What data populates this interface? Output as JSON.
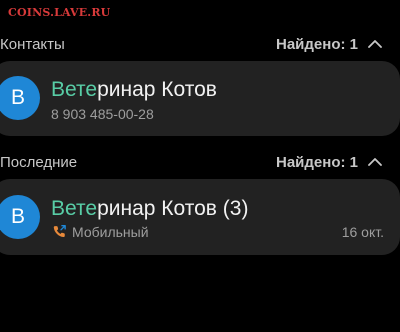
{
  "watermark": "COINS.LAVE.RU",
  "contacts": {
    "title": "Контакты",
    "found": "Найдено: 1",
    "item": {
      "avatar_letter": "В",
      "name_highlight": "Вете",
      "name_rest": "ринар Котов",
      "phone": "8 903 485-00-28"
    }
  },
  "recent": {
    "title": "Последние",
    "found": "Найдено: 1",
    "item": {
      "avatar_letter": "В",
      "name_highlight": "Вете",
      "name_rest": "ринар Котов (3)",
      "call_type": "Мобильный",
      "call_icon": "outgoing-call-icon",
      "date": "16 окт."
    }
  },
  "colors": {
    "background": "#000000",
    "card": "#222222",
    "avatar": "#1f87d6",
    "highlight": "#58cda6",
    "call_icon": "#e8893a",
    "watermark": "#d83a3a"
  }
}
